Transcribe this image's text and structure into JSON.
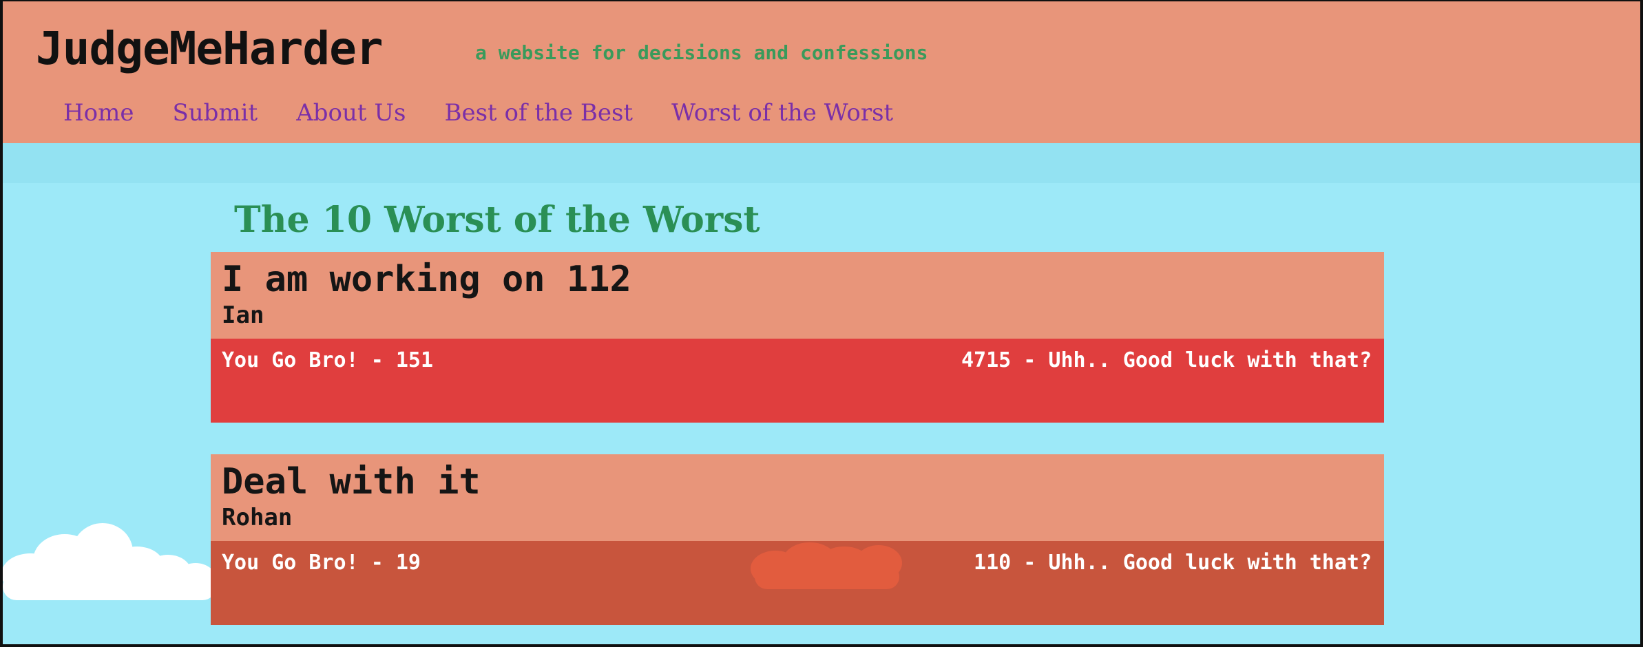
{
  "site": {
    "title": "JudgeMeHarder",
    "tagline": "a website for decisions and confessions"
  },
  "nav": {
    "items": [
      {
        "label": "Home"
      },
      {
        "label": "Submit"
      },
      {
        "label": "About Us"
      },
      {
        "label": "Best of the Best"
      },
      {
        "label": "Worst of the Worst"
      }
    ]
  },
  "main": {
    "heading": "The 10 Worst of the Worst",
    "posts": [
      {
        "title": "I am working on 112",
        "author": "Ian",
        "upvote_label": "You Go Bro! - 151",
        "downvote_label": "4715 - Uhh.. Good luck with that?"
      },
      {
        "title": "Deal with it",
        "author": "Rohan",
        "upvote_label": "You Go Bro! - 19",
        "downvote_label": "110 - Uhh.. Good luck with that?"
      }
    ]
  },
  "colors": {
    "background": "#9de9f8",
    "header": "#e8957a",
    "tagline": "#3a9a5b",
    "nav_link": "#7a2fa8",
    "heading": "#2a8f55",
    "card_top": "#e8957a",
    "card1_bottom": "#e03e3e",
    "card2_bottom": "#c8553d"
  }
}
